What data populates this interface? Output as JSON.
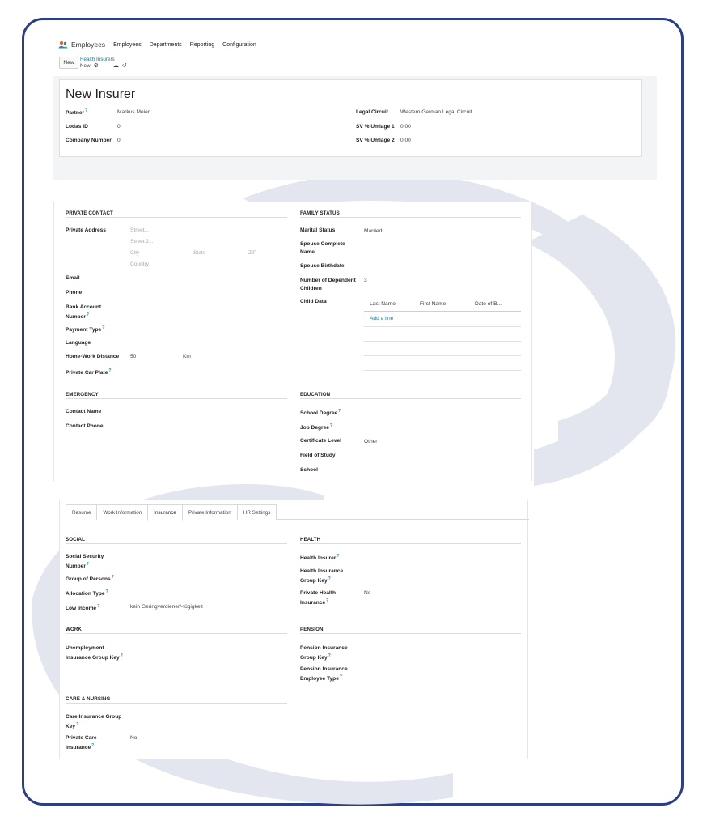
{
  "nav": {
    "app_name": "Employees",
    "menu": [
      "Employees",
      "Departments",
      "Reporting",
      "Configuration"
    ]
  },
  "breadcrumb": {
    "new_button": "New",
    "parent": "Health Insurers",
    "current": "New"
  },
  "insurer": {
    "title": "New Insurer",
    "left": [
      {
        "label": "Partner",
        "value": "Markus Meier",
        "help": true
      },
      {
        "label": "Lodas ID",
        "value": "0",
        "help": false
      },
      {
        "label": "Company Number",
        "value": "0",
        "help": false
      }
    ],
    "right": [
      {
        "label": "Legal Circuit",
        "value": "Western German Legal Circuit"
      },
      {
        "label": "SV % Umlage 1",
        "value": "0.00"
      },
      {
        "label": "SV % Umlage 2",
        "value": "0.00"
      }
    ]
  },
  "private_contact": {
    "heading": "PRIVATE CONTACT",
    "address_label": "Private Address",
    "placeholders": {
      "street": "Street...",
      "street2": "Street 2...",
      "city": "City",
      "state": "State",
      "zip": "ZIP",
      "country": "Country"
    },
    "fields": [
      {
        "label": "Email",
        "value": ""
      },
      {
        "label": "Phone",
        "value": ""
      },
      {
        "label": "Bank Account Number",
        "value": "",
        "help": true
      },
      {
        "label": "Payment Type",
        "value": "",
        "help": true
      },
      {
        "label": "Language",
        "value": ""
      },
      {
        "label": "Home-Work Distance",
        "value": "50",
        "unit": "Km"
      },
      {
        "label": "Private Car Plate",
        "value": "",
        "help": true
      }
    ]
  },
  "family_status": {
    "heading": "FAMILY STATUS",
    "marital_label": "Marital Status",
    "marital_value": "Married",
    "spouse_name_label": "Spouse Complete Name",
    "spouse_birth_label": "Spouse Birthdate",
    "dependents_label": "Number of Dependent Children",
    "dependents_value": "3",
    "child_label": "Child Data",
    "child_columns": [
      "Last Name",
      "First Name",
      "Date of B..."
    ],
    "add_line": "Add a line"
  },
  "emergency": {
    "heading": "EMERGENCY",
    "fields": [
      "Contact Name",
      "Contact Phone"
    ]
  },
  "education": {
    "heading": "EDUCATION",
    "fields": [
      {
        "label": "School Degree",
        "value": "",
        "help": true
      },
      {
        "label": "Job Degree",
        "value": "",
        "help": true
      },
      {
        "label": "Certificate Level",
        "value": "Other",
        "help": false
      },
      {
        "label": "Field of Study",
        "value": "",
        "help": false
      },
      {
        "label": "School",
        "value": "",
        "help": false
      }
    ]
  },
  "tabs": [
    "Resume",
    "Work Information",
    "Insurance",
    "Private Information",
    "HR Settings"
  ],
  "active_tab": "Insurance",
  "social": {
    "heading": "SOCIAL",
    "fields": [
      {
        "label": "Social Security Number",
        "value": "",
        "help": true
      },
      {
        "label": "Group of Persons",
        "value": "",
        "help": true
      },
      {
        "label": "Allocation Type",
        "value": "",
        "help": true
      },
      {
        "label": "Low Income",
        "value": "kein Geringverdiener/-fügigkeit",
        "help": true
      }
    ]
  },
  "health": {
    "heading": "HEALTH",
    "fields": [
      {
        "label": "Health Insurer",
        "value": "",
        "help": true
      },
      {
        "label": "Health Insurance Group Key",
        "value": "",
        "help": true
      },
      {
        "label": "Private Health Insurance",
        "value": "No",
        "help": true
      }
    ]
  },
  "work": {
    "heading": "WORK",
    "fields": [
      {
        "label": "Unemployment Insurance Group Key",
        "value": "",
        "help": true
      }
    ]
  },
  "pension": {
    "heading": "PENSION",
    "fields": [
      {
        "label": "Pension Insurance Group Key",
        "value": "",
        "help": true
      },
      {
        "label": "Pension Insurance Employee Type",
        "value": "",
        "help": true
      }
    ]
  },
  "care": {
    "heading": "CARE & NURSING",
    "fields": [
      {
        "label": "Care Insurance Group Key",
        "value": "",
        "help": true
      },
      {
        "label": "Private Care Insurance",
        "value": "No",
        "help": true
      }
    ]
  },
  "colors": {
    "frame": "#2b3f86",
    "link": "#1a7a8a",
    "help": "#1e7fbf",
    "swirl": "#e3e5ef"
  }
}
